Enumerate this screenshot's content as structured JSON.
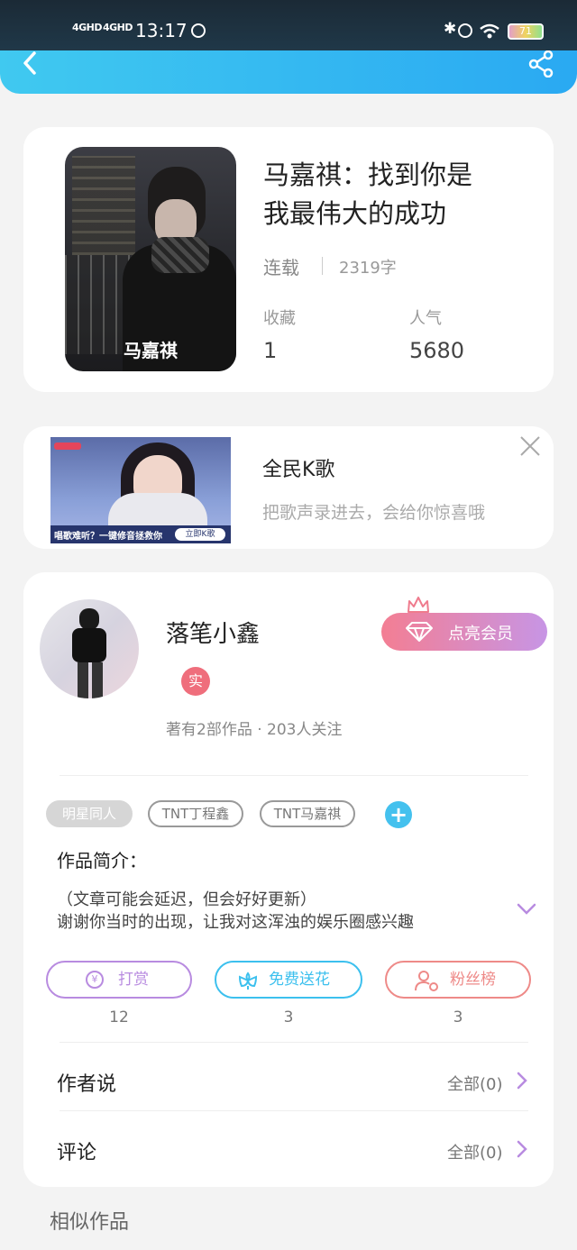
{
  "status_bar": {
    "signal1": "4GHD",
    "signal2": "4GHD",
    "time": "13:17",
    "battery": "71"
  },
  "book": {
    "title_line1": "马嘉祺：找到你是",
    "title_line2": "我最伟大的成功",
    "status": "连载",
    "word_count": "2319字",
    "favorites_label": "收藏",
    "favorites_value": "1",
    "popularity_label": "人气",
    "popularity_value": "5680",
    "cover_text": "马嘉祺"
  },
  "ad": {
    "title": "全民K歌",
    "subtitle": "把歌声录进去，会给你惊喜哦",
    "banner_text": "唱歌难听？一键修音拯救你",
    "banner_button": "立即K歌"
  },
  "author": {
    "name": "落笔小鑫",
    "verified_badge": "实",
    "stats": "著有2部作品 · 203人关注",
    "vip_button": "点亮会员"
  },
  "tags": [
    "明星同人",
    "TNT丁程鑫",
    "TNT马嘉祺"
  ],
  "intro": {
    "label": "作品简介：",
    "line1": "（文章可能会延迟，但会好好更新）",
    "line2": "谢谢你当时的出现，让我对这浑浊的娱乐圈感兴趣"
  },
  "actions": [
    {
      "label": "打赏",
      "count": "12",
      "color": "#b88be0"
    },
    {
      "label": "免费送花",
      "count": "3",
      "color": "#3cc0ee"
    },
    {
      "label": "粉丝榜",
      "count": "3",
      "color": "#ee8a88"
    }
  ],
  "sections": {
    "author_says": "作者说",
    "author_says_link": "全部(0)",
    "comments": "评论",
    "comments_link": "全部(0)",
    "similar": "相似作品"
  },
  "colors": {
    "header": "#2fb4f2",
    "accent_purple": "#b88be0",
    "vip_gradient_start": "#f37e93",
    "vip_gradient_end": "#c795e5"
  }
}
